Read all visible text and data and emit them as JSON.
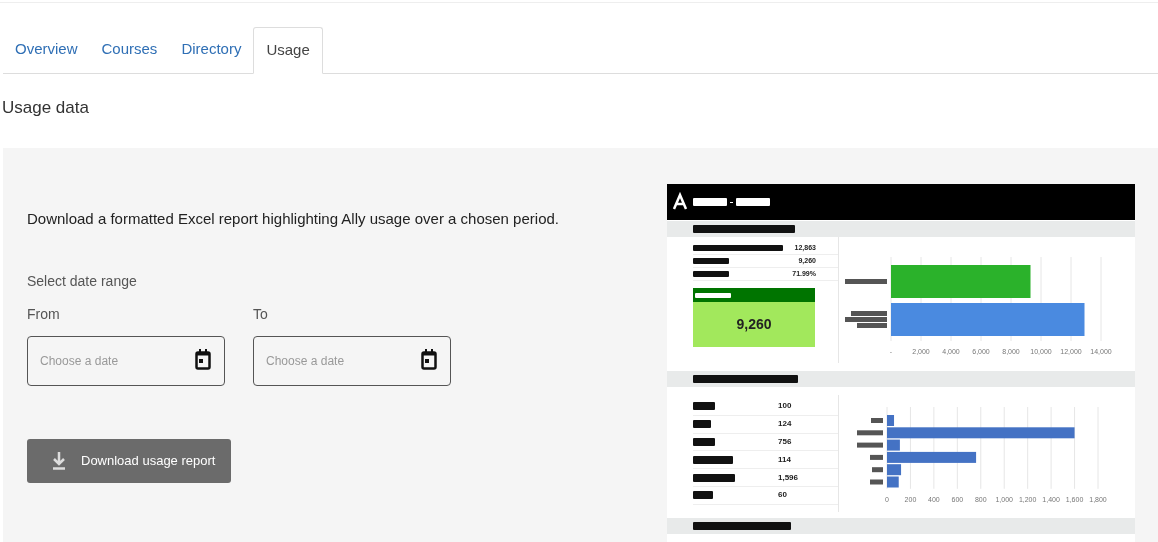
{
  "tabs": [
    {
      "label": "Overview",
      "selected": false
    },
    {
      "label": "Courses",
      "selected": false
    },
    {
      "label": "Directory",
      "selected": false
    },
    {
      "label": "Usage",
      "selected": true
    }
  ],
  "heading": "Usage data",
  "panel": {
    "description": "Download a formatted Excel report highlighting Ally usage over a chosen period.",
    "date_range_label": "Select date range",
    "fields": [
      {
        "label": "From",
        "placeholder": "Choose a date"
      },
      {
        "label": "To",
        "placeholder": "Choose a date"
      }
    ],
    "download_button": "Download usage report"
  },
  "report_preview": {
    "summary_section": {
      "values": [
        "12,863",
        "9,260",
        "71.99%"
      ],
      "highlight_value": "9,260",
      "chart_data": {
        "type": "bar",
        "orientation": "horizontal",
        "stacked": true,
        "series": [
          {
            "color": "#2bb22b",
            "values": [
              9300,
              null
            ]
          },
          {
            "color": "#4a8ae0",
            "values": [
              null,
              12900
            ]
          }
        ],
        "grid": true,
        "xlim": [
          0,
          14000
        ],
        "xticks": [
          {
            "value": 0,
            "label": "-"
          },
          {
            "value": 2000,
            "label": "2,000"
          },
          {
            "value": 4000,
            "label": "4,000"
          },
          {
            "value": 6000,
            "label": "6,000"
          },
          {
            "value": 8000,
            "label": "8,000"
          },
          {
            "value": 10000,
            "label": "10,000"
          },
          {
            "value": 12000,
            "label": "12,000"
          },
          {
            "value": 14000,
            "label": "14,000"
          }
        ]
      }
    },
    "breakdown_section": {
      "values": [
        "100",
        "124",
        "756",
        "114",
        "1,596",
        "60"
      ],
      "chart_data": {
        "type": "bar",
        "orientation": "horizontal",
        "series": [
          {
            "color": "#4472c4",
            "values": [
              60,
              1600,
              110,
              760,
              120,
              100
            ]
          }
        ],
        "grid": true,
        "xlim": [
          0,
          1800
        ],
        "xticks": [
          {
            "value": 0,
            "label": "0"
          },
          {
            "value": 200,
            "label": "200"
          },
          {
            "value": 400,
            "label": "400"
          },
          {
            "value": 600,
            "label": "600"
          },
          {
            "value": 800,
            "label": "800"
          },
          {
            "value": 1000,
            "label": "1,000"
          },
          {
            "value": 1200,
            "label": "1,200"
          },
          {
            "value": 1400,
            "label": "1,400"
          },
          {
            "value": 1600,
            "label": "1,600"
          },
          {
            "value": 1800,
            "label": "1,800"
          }
        ]
      }
    }
  }
}
